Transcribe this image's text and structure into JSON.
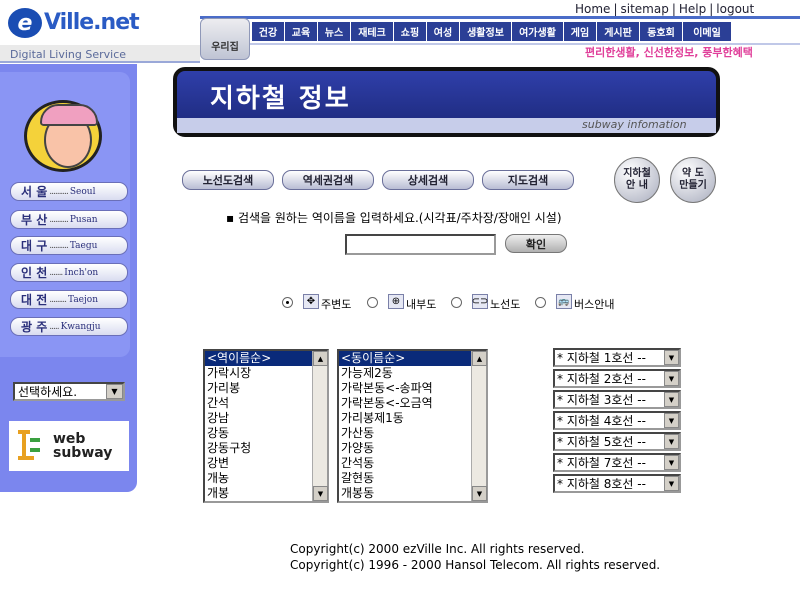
{
  "header": {
    "logo_e": "e",
    "logo_text": "Ville.net",
    "tagline": "Digital Living Service",
    "top_menu": [
      "Home",
      "sitemap",
      "Help",
      "logout"
    ],
    "woori": "우리집",
    "nav": [
      "건강",
      "교육",
      "뉴스",
      "재테크",
      "쇼핑",
      "여성",
      "생활정보",
      "여가생활",
      "게임",
      "게시판",
      "동호회",
      "이메일"
    ],
    "slogan": "편리한생활, 신선한정보, 풍부한혜택"
  },
  "sidebar": {
    "cities": [
      {
        "ko": "서 울",
        "dots": "..........",
        "en": "Seoul"
      },
      {
        "ko": "부 산",
        "dots": "..........",
        "en": "Pusan"
      },
      {
        "ko": "대 구",
        "dots": "..........",
        "en": "Taegu"
      },
      {
        "ko": "인 천",
        "dots": ".......",
        "en": "Inch'on"
      },
      {
        "ko": "대 전",
        "dots": ".........",
        "en": "Taejon"
      },
      {
        "ko": "광 주",
        "dots": ".....",
        "en": "Kwangju"
      }
    ],
    "select_value": "선택하세요.",
    "websubway": [
      "web",
      "subway"
    ]
  },
  "banner": {
    "title": "지하철 정보",
    "subtitle": "subway infomation"
  },
  "search_buttons": [
    "노선도검색",
    "역세권검색",
    "상세검색",
    "지도검색"
  ],
  "circle_buttons": [
    {
      "line1": "지하철",
      "line2": "안 내"
    },
    {
      "line1": "약 도",
      "line2": "만들기"
    }
  ],
  "instruction": "검색을 원하는 역이름을 입력하세요.(시각표/주차장/장애인 시설)",
  "station_input_value": "",
  "confirm_label": "확인",
  "radio_options": [
    {
      "label": "주변도",
      "icon": "crosshair-icon",
      "glyph": "✥",
      "checked": true
    },
    {
      "label": "내부도",
      "icon": "zoom-icon",
      "glyph": "⊕",
      "checked": false
    },
    {
      "label": "노선도",
      "icon": "route-icon",
      "glyph": "⊂⊃",
      "checked": false
    },
    {
      "label": "버스안내",
      "icon": "bus-icon",
      "glyph": "🚌",
      "checked": false
    }
  ],
  "station_list": [
    "<역이름순>",
    "가락시장",
    "가리봉",
    "간석",
    "강남",
    "강동",
    "강동구청",
    "강변",
    "개농",
    "개봉"
  ],
  "dong_list": [
    "<동이름순>",
    "가능제2동",
    "가락본동<-송파역",
    "가락본동<-오금역",
    "가리봉제1동",
    "가산동",
    "가양동",
    "간석동",
    "갈현동",
    "개봉동"
  ],
  "line_selects": [
    "* 지하철 1호선 --",
    "* 지하철 2호선 --",
    "* 지하철 3호선 --",
    "* 지하철 4호선 --",
    "* 지하철 5호선 --",
    "* 지하철 7호선 --",
    "* 지하철 8호선 --"
  ],
  "copyright": [
    "Copyright(c) 2000 ezVille Inc. All rights reserved.",
    "Copyright(c) 1996 - 2000 Hansol Telecom. All rights reserved."
  ]
}
